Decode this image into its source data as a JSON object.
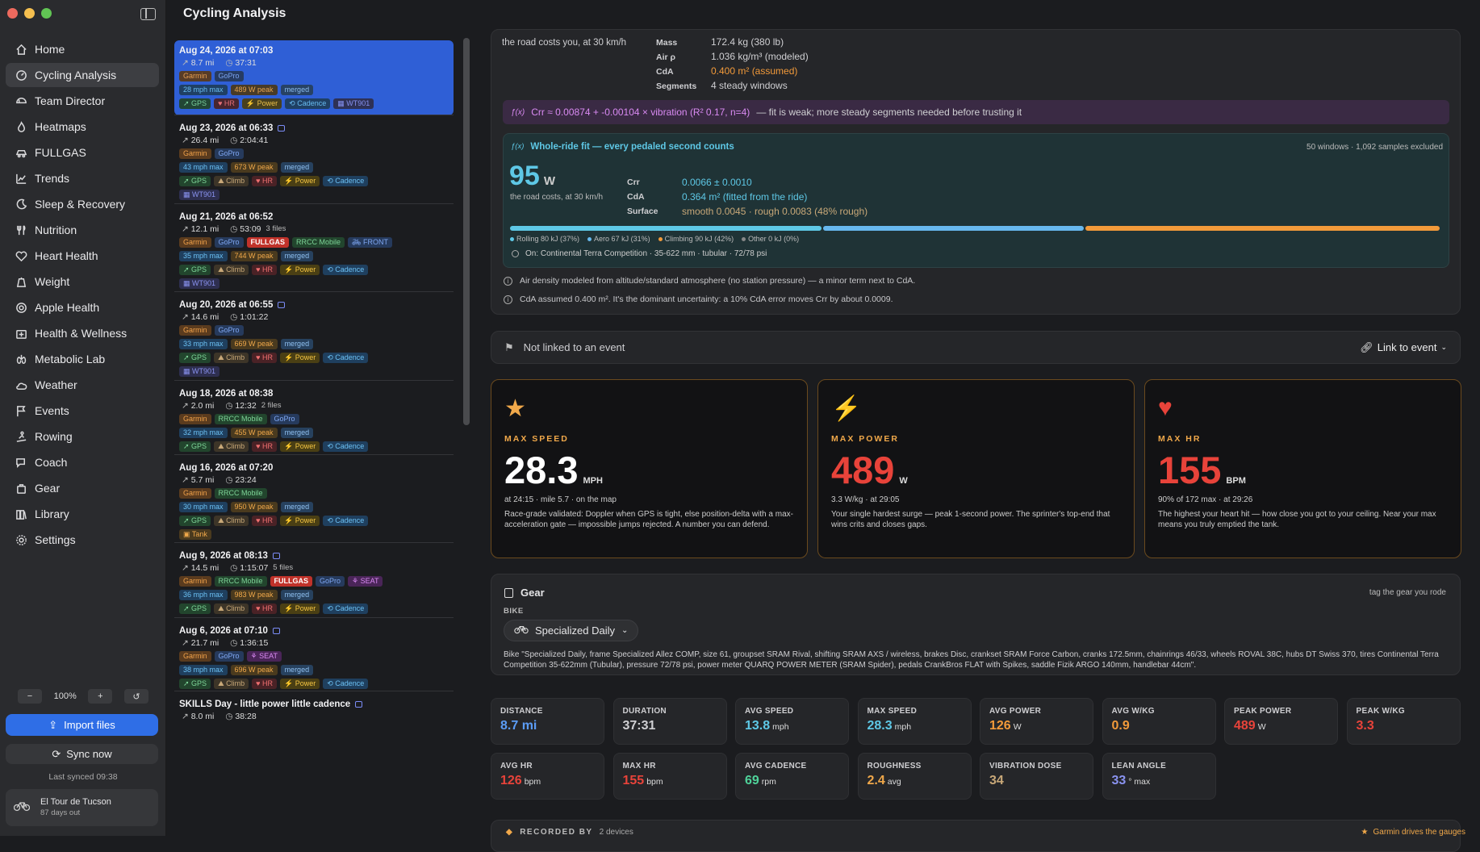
{
  "app": {
    "title": "Cycling Analysis"
  },
  "nav": [
    {
      "label": "Home",
      "icon": "home-icon"
    },
    {
      "label": "Cycling Analysis",
      "icon": "gauge-icon",
      "active": true
    },
    {
      "label": "Team Director",
      "icon": "helmet-icon"
    },
    {
      "label": "Heatmaps",
      "icon": "flame-icon"
    },
    {
      "label": "FULLGAS",
      "icon": "car-icon"
    },
    {
      "label": "Trends",
      "icon": "trend-icon"
    },
    {
      "label": "Sleep & Recovery",
      "icon": "moon-icon"
    },
    {
      "label": "Nutrition",
      "icon": "fork-knife-icon"
    },
    {
      "label": "Heart Health",
      "icon": "heart-pulse-icon"
    },
    {
      "label": "Weight",
      "icon": "scale-icon"
    },
    {
      "label": "Apple Health",
      "icon": "apple-health-icon"
    },
    {
      "label": "Health & Wellness",
      "icon": "medkit-icon"
    },
    {
      "label": "Metabolic Lab",
      "icon": "lungs-icon"
    },
    {
      "label": "Weather",
      "icon": "cloud-sun-icon"
    },
    {
      "label": "Events",
      "icon": "flag-icon"
    },
    {
      "label": "Rowing",
      "icon": "rowing-icon"
    },
    {
      "label": "Coach",
      "icon": "chat-icon"
    },
    {
      "label": "Gear",
      "icon": "bag-icon"
    },
    {
      "label": "Library",
      "icon": "books-icon"
    },
    {
      "label": "Settings",
      "icon": "gear-icon"
    }
  ],
  "zoom": {
    "level": "100%"
  },
  "sidebar_actions": {
    "import": "Import files",
    "sync": "Sync now",
    "last_synced": "Last synced 09:38"
  },
  "event": {
    "title": "El Tour de Tucson",
    "sub": "87 days out"
  },
  "rides": [
    {
      "date": "Aug 24, 2026 at 07:03",
      "cam": false,
      "dist": "8.7 mi",
      "dur": "37:31",
      "files": "",
      "sources": [
        [
          "Garmin",
          "garmin"
        ],
        [
          "GoPro",
          "gopro"
        ]
      ],
      "stats": [
        [
          "28 mph max",
          "speed"
        ],
        [
          "489 W peak",
          "peak"
        ],
        [
          "merged",
          "merged"
        ]
      ],
      "sensors": [
        [
          "GPS",
          "gps"
        ],
        [
          "HR",
          "hr"
        ],
        [
          "Power",
          "power"
        ],
        [
          "Cadence",
          "cad"
        ],
        [
          "WT901",
          "wt"
        ]
      ],
      "extra": []
    },
    {
      "date": "Aug 23, 2026 at 06:33",
      "cam": true,
      "dist": "26.4 mi",
      "dur": "2:04:41",
      "files": "",
      "sources": [
        [
          "Garmin",
          "garmin"
        ],
        [
          "GoPro",
          "gopro"
        ]
      ],
      "stats": [
        [
          "43 mph max",
          "speed"
        ],
        [
          "673 W peak",
          "peak"
        ],
        [
          "merged",
          "merged"
        ]
      ],
      "sensors": [
        [
          "GPS",
          "gps"
        ],
        [
          "Climb",
          "climb"
        ],
        [
          "HR",
          "hr"
        ],
        [
          "Power",
          "power"
        ],
        [
          "Cadence",
          "cad"
        ]
      ],
      "extra": [
        [
          "WT901",
          "wt"
        ]
      ]
    },
    {
      "date": "Aug 21, 2026 at 06:52",
      "cam": false,
      "dist": "12.1 mi",
      "dur": "53:09",
      "files": "3 files",
      "sources": [
        [
          "Garmin",
          "garmin"
        ],
        [
          "GoPro",
          "gopro"
        ],
        [
          "FULLGAS",
          "fullgas"
        ],
        [
          "RRCC Mobile",
          "rrcc"
        ],
        [
          "FRONT",
          "front"
        ]
      ],
      "stats": [
        [
          "35 mph max",
          "speed"
        ],
        [
          "744 W peak",
          "peak"
        ],
        [
          "merged",
          "merged"
        ]
      ],
      "sensors": [
        [
          "GPS",
          "gps"
        ],
        [
          "Climb",
          "climb"
        ],
        [
          "HR",
          "hr"
        ],
        [
          "Power",
          "power"
        ],
        [
          "Cadence",
          "cad"
        ]
      ],
      "extra": [
        [
          "WT901",
          "wt"
        ]
      ]
    },
    {
      "date": "Aug 20, 2026 at 06:55",
      "cam": true,
      "dist": "14.6 mi",
      "dur": "1:01:22",
      "files": "",
      "sources": [
        [
          "Garmin",
          "garmin"
        ],
        [
          "GoPro",
          "gopro"
        ]
      ],
      "stats": [
        [
          "33 mph max",
          "speed"
        ],
        [
          "669 W peak",
          "peak"
        ],
        [
          "merged",
          "merged"
        ]
      ],
      "sensors": [
        [
          "GPS",
          "gps"
        ],
        [
          "Climb",
          "climb"
        ],
        [
          "HR",
          "hr"
        ],
        [
          "Power",
          "power"
        ],
        [
          "Cadence",
          "cad"
        ]
      ],
      "extra": [
        [
          "WT901",
          "wt"
        ]
      ]
    },
    {
      "date": "Aug 18, 2026 at 08:38",
      "cam": false,
      "dist": "2.0 mi",
      "dur": "12:32",
      "files": "2 files",
      "sources": [
        [
          "Garmin",
          "garmin"
        ],
        [
          "RRCC Mobile",
          "rrcc"
        ],
        [
          "GoPro",
          "gopro"
        ]
      ],
      "stats": [
        [
          "32 mph max",
          "speed"
        ],
        [
          "455 W peak",
          "peak"
        ],
        [
          "merged",
          "merged"
        ]
      ],
      "sensors": [
        [
          "GPS",
          "gps"
        ],
        [
          "Climb",
          "climb"
        ],
        [
          "HR",
          "hr"
        ],
        [
          "Power",
          "power"
        ],
        [
          "Cadence",
          "cad"
        ]
      ],
      "extra": []
    },
    {
      "date": "Aug 16, 2026 at 07:20",
      "cam": false,
      "dist": "5.7 mi",
      "dur": "23:24",
      "files": "",
      "sources": [
        [
          "Garmin",
          "garmin"
        ],
        [
          "RRCC Mobile",
          "rrcc"
        ]
      ],
      "stats": [
        [
          "30 mph max",
          "speed"
        ],
        [
          "950 W peak",
          "peak"
        ],
        [
          "merged",
          "merged"
        ]
      ],
      "sensors": [
        [
          "GPS",
          "gps"
        ],
        [
          "Climb",
          "climb"
        ],
        [
          "HR",
          "hr"
        ],
        [
          "Power",
          "power"
        ],
        [
          "Cadence",
          "cad"
        ]
      ],
      "extra": [
        [
          "Tank",
          "tank"
        ]
      ]
    },
    {
      "date": "Aug 9, 2026 at 08:13",
      "cam": true,
      "dist": "14.5 mi",
      "dur": "1:15:07",
      "files": "5 files",
      "sources": [
        [
          "Garmin",
          "garmin"
        ],
        [
          "RRCC Mobile",
          "rrcc"
        ],
        [
          "FULLGAS",
          "fullgas"
        ],
        [
          "GoPro",
          "gopro"
        ],
        [
          "SEAT",
          "seat"
        ]
      ],
      "stats": [
        [
          "36 mph max",
          "speed"
        ],
        [
          "983 W peak",
          "peak"
        ],
        [
          "merged",
          "merged"
        ]
      ],
      "sensors": [
        [
          "GPS",
          "gps"
        ],
        [
          "Climb",
          "climb"
        ],
        [
          "HR",
          "hr"
        ],
        [
          "Power",
          "power"
        ],
        [
          "Cadence",
          "cad"
        ]
      ],
      "extra": []
    },
    {
      "date": "Aug 6, 2026 at 07:10",
      "cam": true,
      "dist": "21.7 mi",
      "dur": "1:36:15",
      "files": "",
      "sources": [
        [
          "Garmin",
          "garmin"
        ],
        [
          "GoPro",
          "gopro"
        ],
        [
          "SEAT",
          "seat"
        ]
      ],
      "stats": [
        [
          "38 mph max",
          "speed"
        ],
        [
          "696 W peak",
          "peak"
        ],
        [
          "merged",
          "merged"
        ]
      ],
      "sensors": [
        [
          "GPS",
          "gps"
        ],
        [
          "Climb",
          "climb"
        ],
        [
          "HR",
          "hr"
        ],
        [
          "Power",
          "power"
        ],
        [
          "Cadence",
          "cad"
        ]
      ],
      "extra": []
    },
    {
      "date": "SKILLS Day - little power little cadence",
      "cam": true,
      "dist": "8.0 mi",
      "dur": "38:28",
      "files": "",
      "sources": [],
      "stats": [],
      "sensors": [],
      "extra": []
    }
  ],
  "physics": {
    "top_caption": "the road costs you, at 30 km/h",
    "rows": [
      [
        "Mass",
        "172.4 kg (380 lb)"
      ],
      [
        "Air ρ",
        "1.036 kg/m³ (modeled)"
      ],
      [
        "CdA",
        "0.400 m² (assumed)"
      ],
      [
        "Segments",
        "4 steady windows"
      ]
    ],
    "formula": "Crr ≈ 0.00874 + -0.00104 × vibration  (R² 0.17, n=4)",
    "formula_note": "— fit is weak; more steady segments needed before trusting it",
    "fit_title": "Whole-ride fit — every pedaled second counts",
    "fit_meta": "50 windows · 1,092 samples excluded",
    "fit_watts": "95",
    "fit_unit": "W",
    "fit_caption": "the road costs, at 30 km/h",
    "fit_rows": [
      [
        "Crr",
        "0.0066 ± 0.0010"
      ],
      [
        "CdA",
        "0.364 m² (fitted from the ride)"
      ],
      [
        "Surface",
        "smooth 0.0045 · rough 0.0083 (48% rough)"
      ]
    ],
    "breakdown": [
      {
        "label": "Rolling 80 kJ (37%)",
        "color": "#5ec8e6",
        "pct": 37
      },
      {
        "label": "Aero 67 kJ (31%)",
        "color": "#67b8ee",
        "pct": 31
      },
      {
        "label": "Climbing 90 kJ (42%)",
        "color": "#f29a3a",
        "pct": 42
      },
      {
        "label": "Other 0 kJ (0%)",
        "color": "#888",
        "pct": 0
      }
    ],
    "tire": "On: Continental Terra Competition · 35-622 mm · tubular · 72/78 psi",
    "notes": [
      "Air density modeled from altitude/standard atmosphere (no station pressure) — a minor term next to CdA.",
      "CdA assumed 0.400 m². It's the dominant uncertainty: a 10% CdA error moves Crr by about 0.0009."
    ]
  },
  "event_link": {
    "status": "Not linked to an event",
    "action": "Link to event"
  },
  "cards": [
    {
      "label": "MAX SPEED",
      "value": "28.3",
      "unit": "MPH",
      "sub": "at 24:15 · mile 5.7 · on the map",
      "desc": "Race-grade validated: Doppler when GPS is tight, else position-delta with a max-acceleration gate — impossible jumps rejected. A number you can defend.",
      "color": "#ffffff",
      "label_color": "#f0a84a",
      "icon": "★"
    },
    {
      "label": "MAX POWER",
      "value": "489",
      "unit": "W",
      "sub": "3.3 W/kg · at 29:05",
      "desc": "Your single hardest surge — peak 1-second power. The sprinter's top-end that wins crits and closes gaps.",
      "color": "#e8433a",
      "label_color": "#f0a84a",
      "icon": "⚡"
    },
    {
      "label": "MAX HR",
      "value": "155",
      "unit": "BPM",
      "sub": "90% of 172 max · at 29:26",
      "desc": "The highest your heart hit — how close you got to your ceiling. Near your max means you truly emptied the tank.",
      "color": "#e8433a",
      "label_color": "#f0a84a",
      "icon": "♥"
    }
  ],
  "gear": {
    "title": "Gear",
    "hint": "tag the gear you rode",
    "bike_label": "BIKE",
    "bike": "Specialized Daily",
    "desc": "Bike \"Specialized Daily, frame Specialized Allez COMP, size 61, groupset SRAM Rival, shifting SRAM AXS / wireless, brakes Disc, crankset SRAM Force Carbon, cranks 172.5mm, chainrings 46/33, wheels ROVAL 38C, hubs DT Swiss 370, tires Continental Terra Competition 35-622mm (Tubular), pressure 72/78 psi, power meter QUARQ POWER METER (SRAM Spider), pedals CrankBros FLAT with Spikes, saddle Fizik ARGO 140mm, handlebar 44cm\"."
  },
  "stats": [
    {
      "label": "DISTANCE",
      "value": "8.7 mi",
      "unit": "",
      "color": "#5b9cf5"
    },
    {
      "label": "DURATION",
      "value": "37:31",
      "unit": "",
      "color": "#cfcfd2"
    },
    {
      "label": "AVG SPEED",
      "value": "13.8",
      "unit": "mph",
      "color": "#5ec8e6"
    },
    {
      "label": "MAX SPEED",
      "value": "28.3",
      "unit": "mph",
      "color": "#5ec8e6"
    },
    {
      "label": "AVG POWER",
      "value": "126",
      "unit": "W",
      "color": "#f29a3a"
    },
    {
      "label": "AVG W/KG",
      "value": "0.9",
      "unit": "",
      "color": "#f29a3a"
    },
    {
      "label": "PEAK POWER",
      "value": "489",
      "unit": "W",
      "color": "#e8433a"
    },
    {
      "label": "PEAK W/KG",
      "value": "3.3",
      "unit": "",
      "color": "#e8433a"
    },
    {
      "label": "AVG HR",
      "value": "126",
      "unit": "bpm",
      "color": "#e8433a"
    },
    {
      "label": "MAX HR",
      "value": "155",
      "unit": "bpm",
      "color": "#e8433a"
    },
    {
      "label": "AVG CADENCE",
      "value": "69",
      "unit": "rpm",
      "color": "#4fd39a"
    },
    {
      "label": "ROUGHNESS",
      "value": "2.4",
      "unit": "avg",
      "color": "#f0a84a"
    },
    {
      "label": "VIBRATION DOSE",
      "value": "34",
      "unit": "",
      "color": "#c8a878"
    },
    {
      "label": "LEAN ANGLE",
      "value": "33",
      "unit": "° max",
      "color": "#8a93f0"
    }
  ],
  "recorded": {
    "title": "RECORDED BY",
    "count": "2 devices",
    "note": "Garmin drives the gauges"
  },
  "colors": {
    "accent": "#2f6ee6",
    "fullgas": "#c0322a"
  }
}
